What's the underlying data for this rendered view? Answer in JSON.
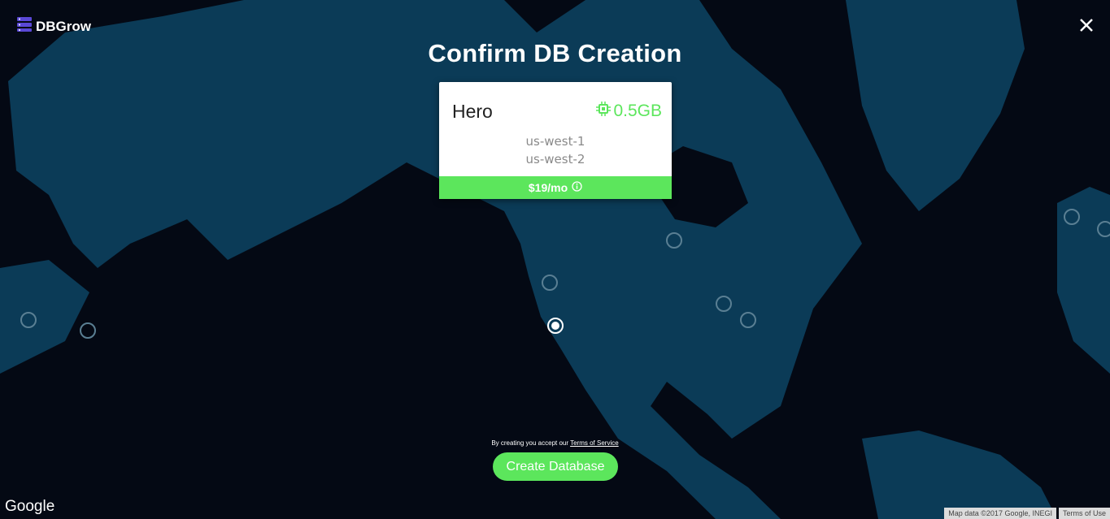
{
  "brand": {
    "name": "DBGrow"
  },
  "header": {
    "title": "Confirm DB Creation"
  },
  "plan": {
    "name": "Hero",
    "size": "0.5GB",
    "regions": [
      "us-west-1",
      "us-west-2"
    ],
    "price": "$19/mo"
  },
  "footer": {
    "terms_prefix": "By creating you accept our",
    "terms_link": "Terms of Service",
    "create_label": "Create Database"
  },
  "map": {
    "logo": "Google",
    "data_attribution": "Map data ©2017 Google, INEGI",
    "terms_of_use": "Terms of Use",
    "selected_marker": "us-west-1"
  },
  "colors": {
    "accent": "#5ce65c",
    "ocean": "#040914",
    "land": "#0b3b57",
    "brand_icon": "#5a48d6"
  },
  "icons": [
    "database-icon",
    "close-icon",
    "chip-icon",
    "info-icon"
  ]
}
